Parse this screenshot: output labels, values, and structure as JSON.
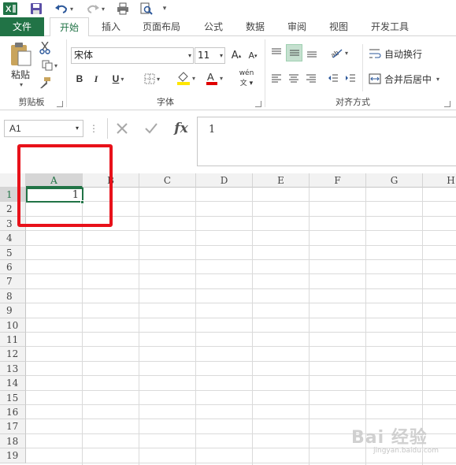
{
  "quick_access": {
    "app_icon": "excel-icon",
    "save_icon": "save-icon",
    "undo_icon": "undo-icon",
    "redo_icon": "redo-icon",
    "print_icon": "print-icon",
    "print_preview_icon": "print-preview-icon",
    "customize_icon": "customize-toolbar-icon"
  },
  "tabs": [
    {
      "label": "文件"
    },
    {
      "label": "开始"
    },
    {
      "label": "插入"
    },
    {
      "label": "页面布局"
    },
    {
      "label": "公式"
    },
    {
      "label": "数据"
    },
    {
      "label": "审阅"
    },
    {
      "label": "视图"
    },
    {
      "label": "开发工具"
    }
  ],
  "ribbon": {
    "clipboard": {
      "label": "剪贴板",
      "paste_label": "粘贴"
    },
    "font": {
      "label": "字体",
      "font_name": "宋体",
      "font_size": "11",
      "bold": "B",
      "italic": "I",
      "underline": "U",
      "phonetic_label": "wén"
    },
    "alignment": {
      "label": "对齐方式",
      "wrap_text": "自动换行",
      "merge_center": "合并后居中"
    }
  },
  "formula_bar": {
    "name_box": "A1",
    "fx_label": "fx",
    "formula": "1"
  },
  "grid": {
    "columns": [
      "A",
      "B",
      "C",
      "D",
      "E",
      "F",
      "G",
      "H"
    ],
    "rows": [
      "1",
      "2",
      "3",
      "4",
      "5",
      "6",
      "7",
      "8",
      "9",
      "10",
      "11",
      "12",
      "13",
      "14",
      "15",
      "16",
      "17",
      "18",
      "19"
    ],
    "active_cell_value": "1"
  },
  "watermark": {
    "main": "Bai 经验",
    "sub": "jingyan.baidu.com"
  },
  "colors": {
    "excel_green": "#217346",
    "highlight_red": "#e8111a"
  }
}
